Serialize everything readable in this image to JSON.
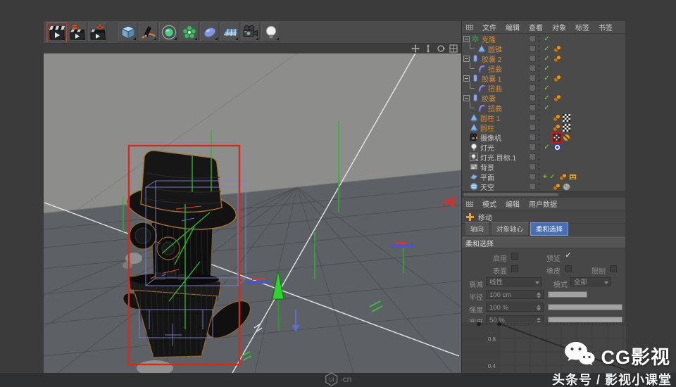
{
  "toolbar": {
    "render_icons": [
      "render-view",
      "render-picture-viewer",
      "render-settings"
    ],
    "create_icons": [
      "add-cube",
      "spline-pen",
      "generators",
      "deformers",
      "metaball",
      "floor",
      "camera",
      "light"
    ]
  },
  "viewport": {
    "nav_icons": [
      "pan-icon",
      "zoom-icon",
      "orbit-icon",
      "toggle-view-icon"
    ]
  },
  "object_manager": {
    "menu": [
      "文件",
      "编辑",
      "查看",
      "对象",
      "标签",
      "书签"
    ],
    "rows": [
      {
        "label": "克隆",
        "icon": "cloner",
        "selected": true,
        "expand": true,
        "check": true,
        "tags": []
      },
      {
        "label": "圆锥",
        "icon": "cone",
        "selected": true,
        "child": true,
        "check": true,
        "tags": [
          "phong"
        ]
      },
      {
        "label": "胶囊 2",
        "icon": "capsule",
        "selected": true,
        "expand": true,
        "check": true,
        "tags": [
          "phong"
        ]
      },
      {
        "label": "扭曲",
        "icon": "bend",
        "selected": true,
        "child": true,
        "check": true,
        "tags": []
      },
      {
        "label": "胶囊 1",
        "icon": "capsule",
        "selected": true,
        "expand": true,
        "check": true,
        "tags": [
          "phong"
        ]
      },
      {
        "label": "扭曲",
        "icon": "bend",
        "selected": true,
        "child": true,
        "check": true,
        "tags": []
      },
      {
        "label": "胶囊",
        "icon": "capsule",
        "selected": true,
        "expand": true,
        "check": true,
        "tags": [
          "phong"
        ]
      },
      {
        "label": "扭曲",
        "icon": "bend",
        "selected": true,
        "child": true,
        "check": true,
        "tags": []
      },
      {
        "label": "圆柱 1",
        "icon": "cone",
        "selected": true,
        "tags": [
          "phong",
          "checker"
        ]
      },
      {
        "label": "圆柱",
        "icon": "cone",
        "selected": true,
        "tags": [
          "phong",
          "checker"
        ]
      },
      {
        "label": "摄像机",
        "icon": "camera",
        "highlight": "red-box",
        "tags": [
          "target-red",
          "forbid"
        ]
      },
      {
        "label": "灯光",
        "icon": "light",
        "check": true,
        "tags": [
          "target-blue"
        ]
      },
      {
        "label": "灯光.目标.1",
        "icon": "light-target",
        "tags": []
      },
      {
        "label": "背景",
        "icon": "background",
        "tags": []
      },
      {
        "label": "平面",
        "icon": "plane",
        "plus": true,
        "check": true,
        "tags": [
          "phong",
          "eye"
        ]
      },
      {
        "label": "天空",
        "icon": "sky",
        "tags": [
          "phong",
          "graytex"
        ]
      }
    ]
  },
  "attribute_manager": {
    "menu": [
      "模式",
      "编辑",
      "用户数据"
    ],
    "tool_label": "移动",
    "tabs": [
      {
        "label": "轴向",
        "active": false
      },
      {
        "label": "对象轴心",
        "active": false
      },
      {
        "label": "柔和选择",
        "active": true
      }
    ],
    "section_title": "柔和选择",
    "fields": {
      "enable_label": "启用",
      "enable_checked": false,
      "preview_label": "预览",
      "preview_checked": true,
      "surface_label": "表面",
      "surface_checked": false,
      "rubber_label": "橡皮",
      "rubber_checked": false,
      "restrict_label": "限制",
      "restrict_checked": false,
      "falloff_label": "衰减",
      "falloff_value": "线性",
      "mode_label": "模式",
      "mode_value": "全部",
      "radius_label": "半径",
      "radius_value": "100 cm",
      "strength_label": "强度",
      "strength_value": "100 %",
      "width_label": "宽度",
      "width_value": "50 %"
    }
  },
  "falloff_curve": {
    "y_tick_labels": [
      "0.8",
      "0.4"
    ],
    "points": [
      {
        "x": 0,
        "y": 1.0
      },
      {
        "x": 1,
        "y": 0.63
      }
    ]
  },
  "watermarks": {
    "channel_name": "CG影视",
    "byline": "头条号 / 影视小课堂",
    "site_badge": "UI",
    "site_suffix": "·cn"
  },
  "colors": {
    "selected_text": "#d08a3e",
    "tab_active": "#4a6fb0",
    "highlight_red": "#d62a1c",
    "check_green": "#7ec850"
  }
}
